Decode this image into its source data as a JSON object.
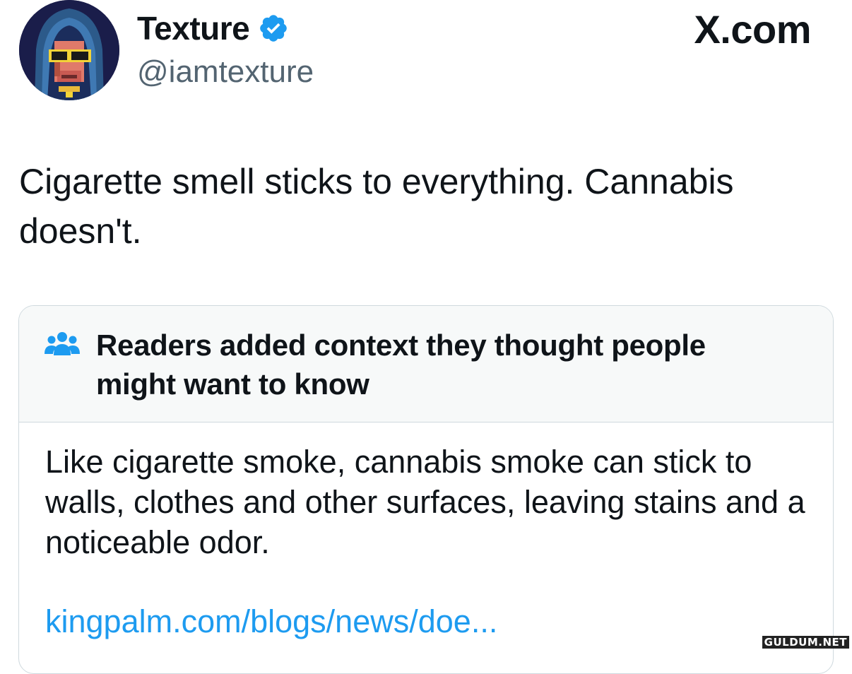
{
  "header": {
    "display_name": "Texture",
    "handle": "@iamtexture",
    "brand": "X.com",
    "verified": true
  },
  "tweet": {
    "text": "Cigarette smell sticks to everything. Cannabis doesn't."
  },
  "community_note": {
    "title": "Readers added context they thought people might want to know",
    "body": "Like cigarette smoke, cannabis smoke can stick to walls, clothes and other surfaces, leaving stains and a noticeable odor.",
    "link_text": "kingpalm.com/blogs/news/doe..."
  },
  "watermark": "GULDUM.NET",
  "icons": {
    "verified": "verified-badge-icon",
    "readers": "people-group-icon"
  },
  "colors": {
    "verified_blue": "#1d9bf0",
    "link_blue": "#1d9bf0",
    "handle_gray": "#536471",
    "note_header_bg": "#f7f9f9",
    "border": "#cfd9de"
  }
}
